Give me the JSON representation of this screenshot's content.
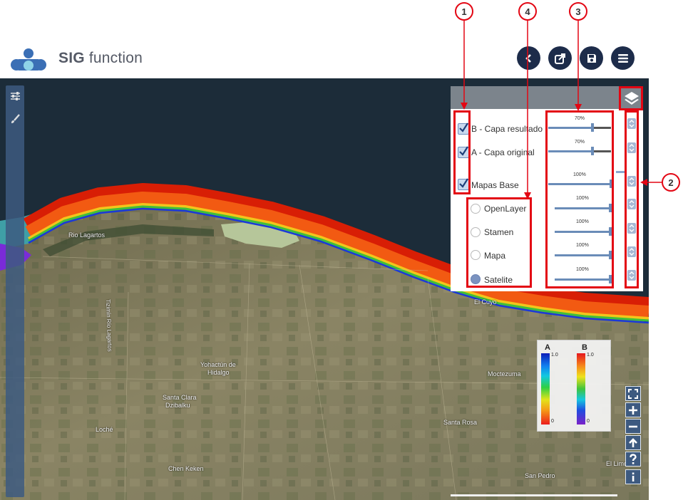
{
  "app": {
    "brand_bold": "SIG",
    "brand_rest": "function"
  },
  "header": {
    "buttons": [
      {
        "name": "back-button",
        "icon": "chevron-left-icon"
      },
      {
        "name": "share-button",
        "icon": "share-icon"
      },
      {
        "name": "save-button",
        "icon": "floppy-disk-icon"
      },
      {
        "name": "menu-button",
        "icon": "hamburger-icon"
      }
    ]
  },
  "left_toolbar": {
    "icons": [
      "sliders-icon",
      "paintbrush-icon"
    ]
  },
  "layer_panel": {
    "layers": [
      {
        "label": "B - Capa resultado",
        "checked": true,
        "opacity": "70%"
      },
      {
        "label": "A - Capa original",
        "checked": true,
        "opacity": "70%"
      },
      {
        "label": "Mapas Base",
        "checked": true,
        "opacity": "100%"
      }
    ],
    "base_maps": [
      {
        "label": "OpenLayer",
        "selected": false,
        "opacity": "100%"
      },
      {
        "label": "Stamen",
        "selected": false,
        "opacity": "100%"
      },
      {
        "label": "Mapa",
        "selected": false,
        "opacity": "100%"
      },
      {
        "label": "Satelite",
        "selected": true,
        "opacity": "100%"
      }
    ]
  },
  "callouts": [
    "1",
    "2",
    "3",
    "4"
  ],
  "legend": {
    "a": {
      "label": "A",
      "max": "1.0",
      "min": "0"
    },
    "b": {
      "label": "B",
      "max": "1.0",
      "min": "0"
    }
  },
  "map_labels": {
    "rio_lagartos": "Rio Lagartos",
    "tizimin_rio_lagartos": "Tizimín Río Lagartos",
    "el_cuyo": "El Cuyo",
    "yohactun_1": "Yohactún de",
    "yohactun_2": "Hidalgo",
    "moctezuma": "Moctezuma",
    "santa_clara_1": "Santa Clara",
    "santa_clara_2": "Dzibalku",
    "loche": "Loché",
    "santa_rosa": "Santa Rosa",
    "chen_keken": "Chen Keken",
    "san_pedro": "San Pedro",
    "el_limon": "El Limo"
  },
  "map_controls": [
    "fullscreen-icon",
    "zoom-in-icon",
    "zoom-out-icon",
    "north-arrow-icon",
    "help-icon",
    "info-icon"
  ],
  "colors": {
    "header_button": "#1d2c4a",
    "toolbar": "#3d5a80",
    "annotation": "#e30613",
    "logo": "#3b6fb5"
  }
}
